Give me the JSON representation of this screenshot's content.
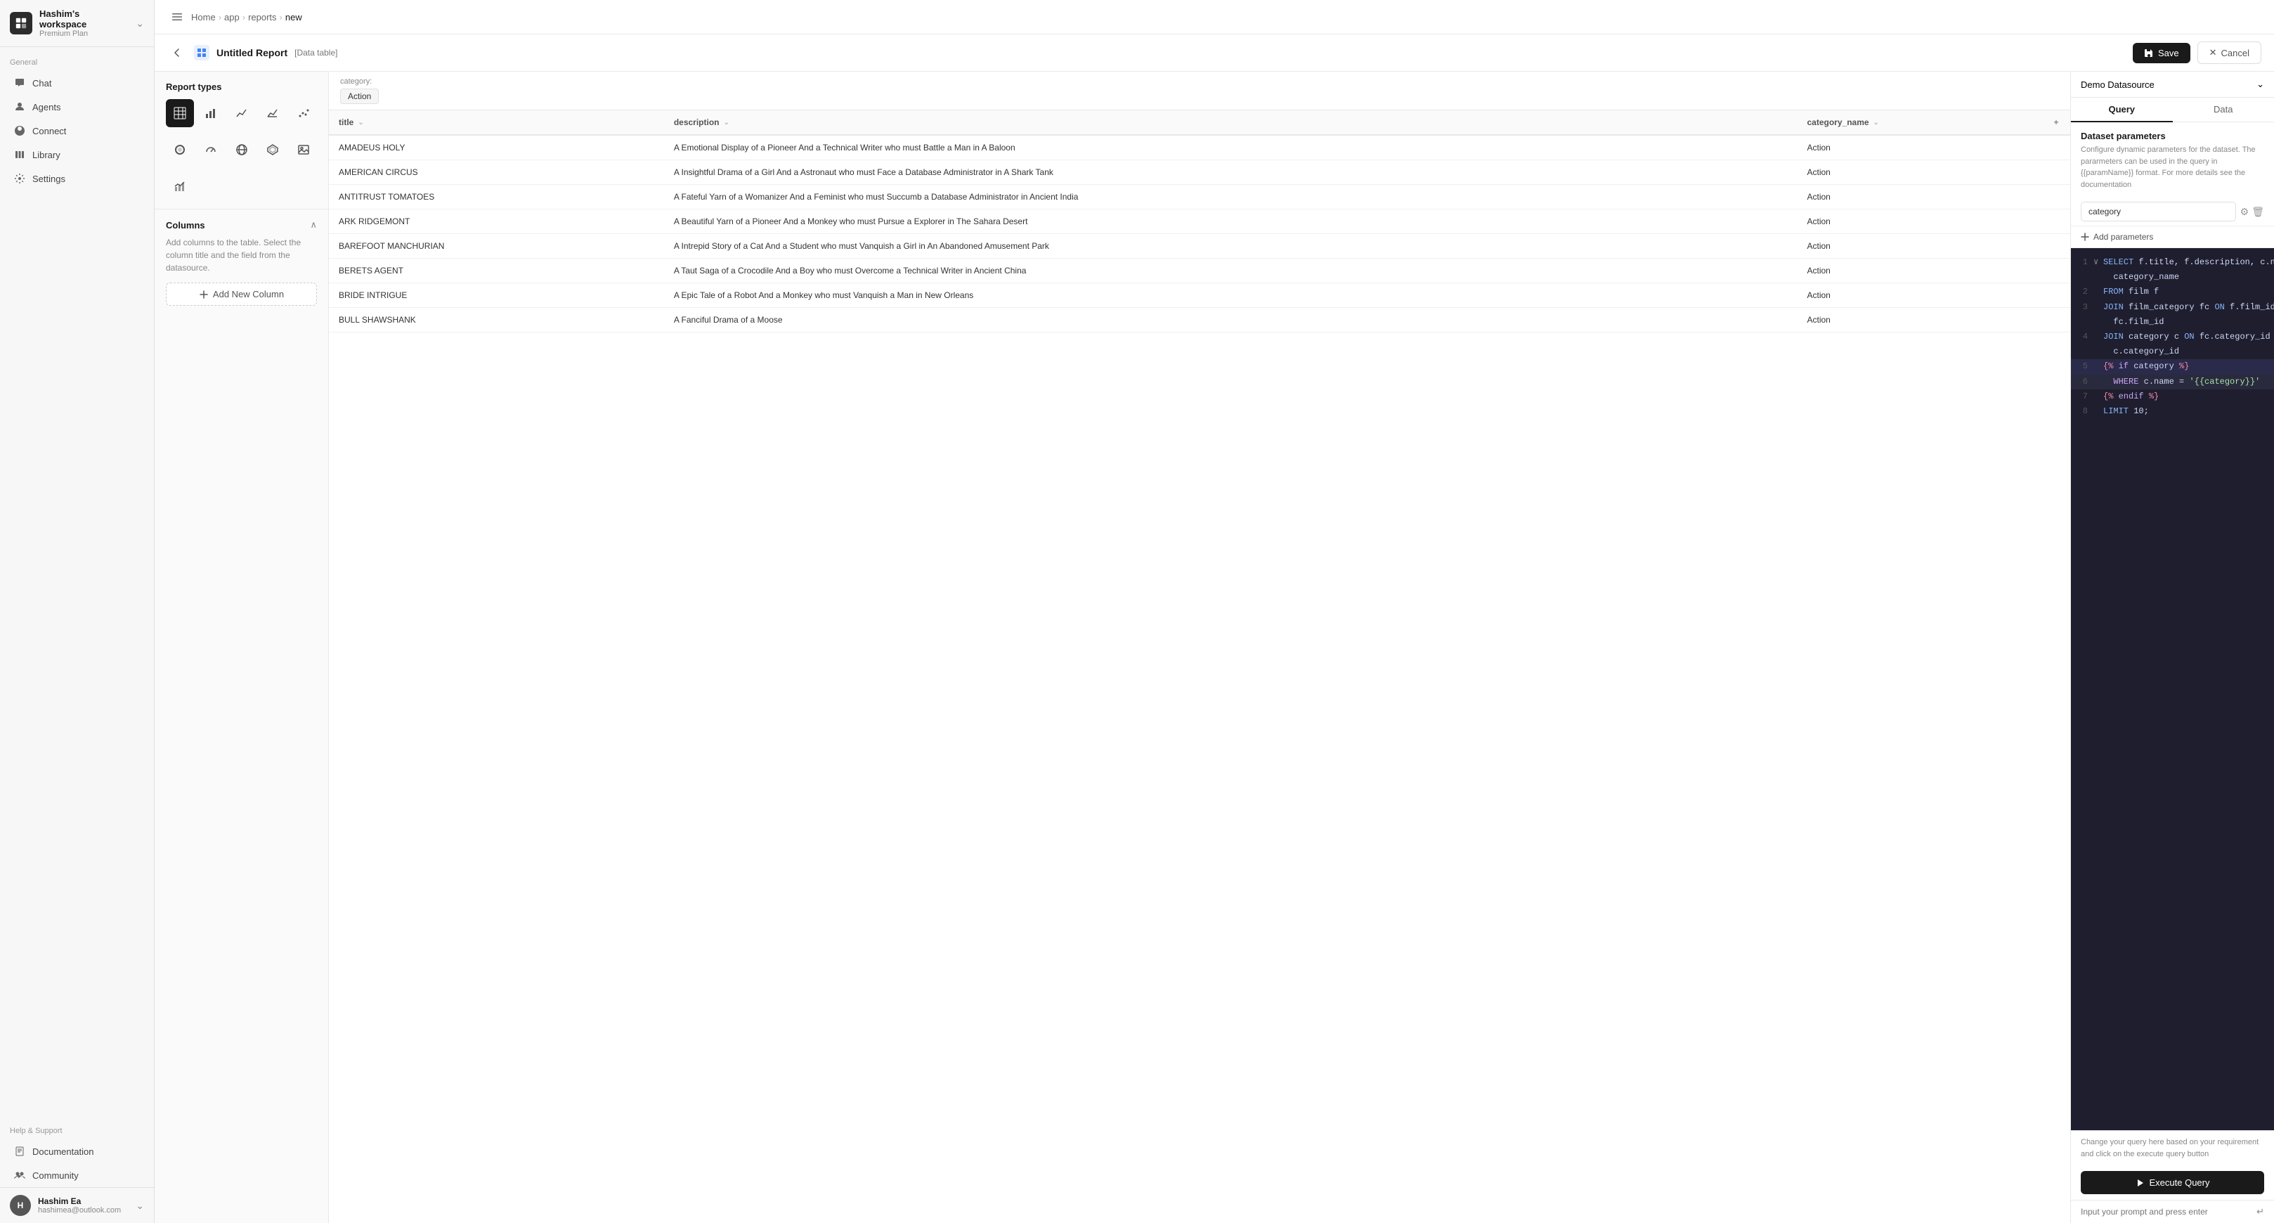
{
  "workspace": {
    "name": "Hashim's workspace",
    "plan": "Premium Plan"
  },
  "sidebar": {
    "general_label": "General",
    "items": [
      {
        "id": "chat",
        "label": "Chat"
      },
      {
        "id": "agents",
        "label": "Agents"
      },
      {
        "id": "connect",
        "label": "Connect"
      },
      {
        "id": "library",
        "label": "Library"
      },
      {
        "id": "settings",
        "label": "Settings"
      }
    ],
    "help_label": "Help & Support",
    "help_items": [
      {
        "id": "documentation",
        "label": "Documentation"
      },
      {
        "id": "community",
        "label": "Community"
      }
    ]
  },
  "user": {
    "name": "Hashim Ea",
    "email": "hashimea@outlook.com",
    "initials": "H"
  },
  "breadcrumb": {
    "items": [
      "Home",
      "app",
      "reports",
      "new"
    ]
  },
  "toolbar": {
    "report_title": "Untitled Report",
    "report_type": "[Data table]",
    "save_label": "Save",
    "cancel_label": "Cancel"
  },
  "report_types": {
    "section_title": "Report types",
    "chart_types": [
      {
        "id": "table",
        "icon": "⊞",
        "active": true
      },
      {
        "id": "bar",
        "icon": "📊"
      },
      {
        "id": "line",
        "icon": "📈"
      },
      {
        "id": "area",
        "icon": "📉"
      },
      {
        "id": "scatter",
        "icon": "⚬"
      }
    ],
    "chart_types_row2": [
      {
        "id": "donut",
        "icon": "◎"
      },
      {
        "id": "gauge",
        "icon": "⊕"
      },
      {
        "id": "geo",
        "icon": "⊕"
      },
      {
        "id": "radar",
        "icon": "⬡"
      },
      {
        "id": "image",
        "icon": "⬜"
      }
    ],
    "chart_types_row3": [
      {
        "id": "combined",
        "icon": "⊟"
      }
    ]
  },
  "columns": {
    "section_title": "Columns",
    "description": "Add columns to the table. Select the column title and the field from the datasource.",
    "add_column_label": "Add New Column"
  },
  "filter": {
    "label": "category:",
    "value": "Action"
  },
  "table": {
    "columns": [
      {
        "id": "title",
        "label": "title"
      },
      {
        "id": "description",
        "label": "description"
      },
      {
        "id": "category_name",
        "label": "category_name"
      }
    ],
    "rows": [
      {
        "title": "AMADEUS HOLY",
        "description": "A Emotional Display of a Pioneer And a Technical Writer who must Battle a Man in A Baloon",
        "category": "Action"
      },
      {
        "title": "AMERICAN CIRCUS",
        "description": "A Insightful Drama of a Girl And a Astronaut who must Face a Database Administrator in A Shark Tank",
        "category": "Action"
      },
      {
        "title": "ANTITRUST TOMATOES",
        "description": "A Fateful Yarn of a Womanizer And a Feminist who must Succumb a Database Administrator in Ancient India",
        "category": "Action"
      },
      {
        "title": "ARK RIDGEMONT",
        "description": "A Beautiful Yarn of a Pioneer And a Monkey who must Pursue a Explorer in The Sahara Desert",
        "category": "Action"
      },
      {
        "title": "BAREFOOT MANCHURIAN",
        "description": "A Intrepid Story of a Cat And a Student who must Vanquish a Girl in An Abandoned Amusement Park",
        "category": "Action"
      },
      {
        "title": "BERETS AGENT",
        "description": "A Taut Saga of a Crocodile And a Boy who must Overcome a Technical Writer in Ancient China",
        "category": "Action"
      },
      {
        "title": "BRIDE INTRIGUE",
        "description": "A Epic Tale of a Robot And a Monkey who must Vanquish a Man in New Orleans",
        "category": "Action"
      },
      {
        "title": "BULL SHAWSHANK",
        "description": "A Fanciful Drama of a Moose",
        "category": "Action"
      }
    ]
  },
  "right_panel": {
    "datasource": "Demo Datasource",
    "tab_query": "Query",
    "tab_data": "Data",
    "dataset_params_title": "Dataset parameters",
    "dataset_params_desc": "Configure dynamic parameters for the dataset. The pararmeters can be used in the query in {{paramName}} format. For more details see the documentation",
    "param_name": "category",
    "add_params_label": "Add parameters",
    "query_note": "Change your query here based on your requirement and click on the execute query button",
    "execute_label": "Execute Query",
    "prompt_placeholder": "Input your prompt and press enter",
    "code_lines": [
      {
        "num": 1,
        "content": "SELECT f.title, f.description, c.name AS category_name",
        "has_caret": true
      },
      {
        "num": 2,
        "content": "FROM film f"
      },
      {
        "num": 3,
        "content": "JOIN film_category fc ON f.film_id = fc.film_id"
      },
      {
        "num": 4,
        "content": "JOIN category c ON fc.category_id = c.category_id"
      },
      {
        "num": 5,
        "content": "{% if category %}",
        "highlight": true
      },
      {
        "num": 6,
        "content": "  WHERE c.name = '{{category}}'",
        "highlight2": true
      },
      {
        "num": 7,
        "content": "{% endif %}"
      },
      {
        "num": 8,
        "content": "LIMIT 10;"
      }
    ]
  }
}
